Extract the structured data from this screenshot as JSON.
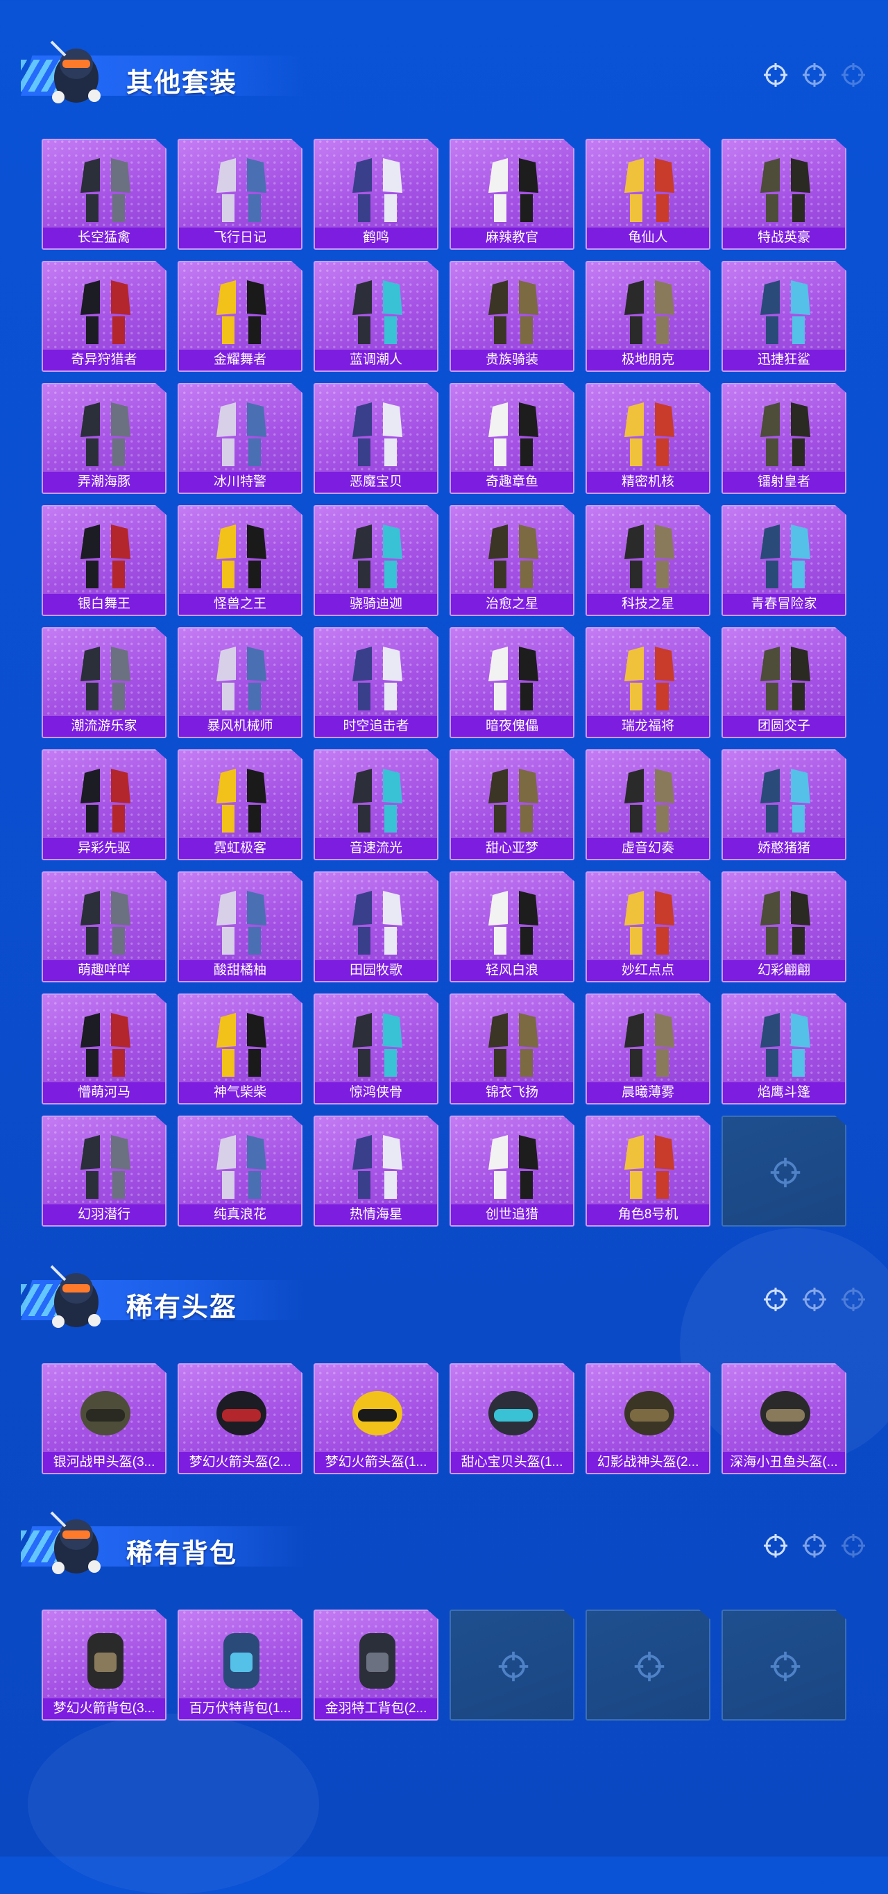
{
  "colors": {
    "card_purple": "#a451e4",
    "label_bar": "#7d1de0",
    "empty_slot": "#1f4f8e",
    "background_blue": "#0a52d6"
  },
  "sections": [
    {
      "title": "其他套装",
      "icons": [
        "crosshair-icon",
        "crosshair-icon",
        "crosshair-icon"
      ],
      "items": [
        "长空猛禽",
        "飞行日记",
        "鹤鸣",
        "麻辣教官",
        "龟仙人",
        "特战英豪",
        "奇异狩猎者",
        "金耀舞者",
        "蓝调潮人",
        "贵族骑装",
        "极地朋克",
        "迅捷狂鲨",
        "弄潮海豚",
        "冰川特警",
        "恶魔宝贝",
        "奇趣章鱼",
        "精密机核",
        "镭射皇者",
        "银白舞王",
        "怪兽之王",
        "骁骑迪迦",
        "治愈之星",
        "科技之星",
        "青春冒险家",
        "潮流游乐家",
        "暴风机械师",
        "时空追击者",
        "暗夜傀儡",
        "瑞龙福将",
        "团圆交子",
        "异彩先驱",
        "霓虹极客",
        "音速流光",
        "甜心亚梦",
        "虚音幻奏",
        "娇憨猪猪",
        "萌趣咩咩",
        "酸甜橘柚",
        "田园牧歌",
        "轻风白浪",
        "妙红点点",
        "幻彩翩翩",
        "懵萌河马",
        "神气柴柴",
        "惊鸿侠骨",
        "锦衣飞扬",
        "晨曦薄雾",
        "焰鹰斗篷",
        "幻羽潜行",
        "纯真浪花",
        "热情海星",
        "创世追猎",
        "角色8号机"
      ],
      "empty_slots": 1
    },
    {
      "title": "稀有头盔",
      "icons": [
        "crosshair-icon",
        "crosshair-icon",
        "crosshair-icon"
      ],
      "items": [
        "银河战甲头盔(3...",
        "梦幻火箭头盔(2...",
        "梦幻火箭头盔(1...",
        "甜心宝贝头盔(1...",
        "幻影战神头盔(2...",
        "深海小丑鱼头盔(..."
      ],
      "empty_slots": 0
    },
    {
      "title": "稀有背包",
      "icons": [
        "crosshair-icon",
        "crosshair-icon",
        "crosshair-icon"
      ],
      "items": [
        "梦幻火箭背包(3...",
        "百万伏特背包(1...",
        "金羽特工背包(2..."
      ],
      "empty_slots": 3
    }
  ]
}
